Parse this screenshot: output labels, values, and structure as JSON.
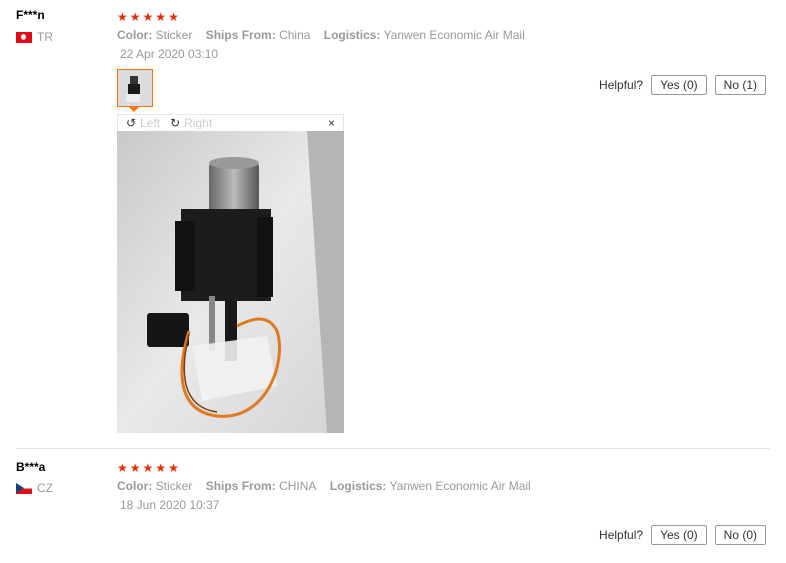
{
  "reviews": [
    {
      "user": "F***n",
      "country": "TR",
      "rating": 5,
      "color_label": "Color:",
      "color_value": "Sticker",
      "ships_label": "Ships From:",
      "ships_value": "China",
      "logistics_label": "Logistics:",
      "logistics_value": "Yanwen Economic Air Mail",
      "date": "22 Apr 2020 03:10",
      "helpful_label": "Helpful?",
      "yes_label": "Yes (0)",
      "no_label": "No (1)",
      "viewer": {
        "rotate_left": "Left",
        "rotate_right": "Right",
        "close": "×"
      }
    },
    {
      "user": "B***a",
      "country": "CZ",
      "rating": 5,
      "color_label": "Color:",
      "color_value": "Sticker",
      "ships_label": "Ships From:",
      "ships_value": "CHINA",
      "logistics_label": "Logistics:",
      "logistics_value": "Yanwen Economic Air Mail",
      "date": "18 Jun 2020 10:37",
      "helpful_label": "Helpful?",
      "yes_label": "Yes (0)",
      "no_label": "No (0)"
    }
  ],
  "colors": {
    "star": "#e62e04",
    "thumb_border": "#ff7300",
    "muted_text": "#999999"
  }
}
